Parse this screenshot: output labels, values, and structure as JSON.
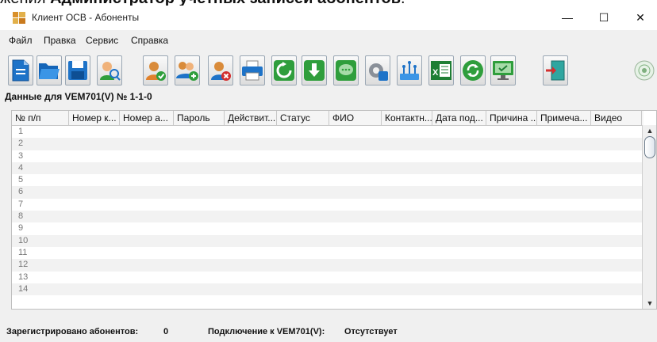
{
  "doc": {
    "prefix": "жения ",
    "bold": "Администратор учетных записей абонентов",
    "suffix": "."
  },
  "window": {
    "title": "Клиент ОСВ - Абоненты",
    "minimize": "—",
    "maximize": "☐",
    "close": "✕"
  },
  "menu": [
    "Файл",
    "Правка",
    "Сервис",
    "Справка"
  ],
  "toolbar": {
    "buttons": [
      "new-document-icon",
      "open-folder-icon",
      "save-icon",
      "search-user-icon",
      "user-check-icon",
      "add-users-icon",
      "remove-user-icon",
      "printer-icon",
      "refresh-icon",
      "download-icon",
      "chat-icon",
      "settings-icon",
      "network-icon",
      "excel-icon",
      "sync-icon",
      "monitor-icon",
      "exit-door-icon"
    ],
    "colors": {
      "accent": "#1e73c8",
      "green": "#2f9e3c",
      "gray": "#8a9099"
    }
  },
  "caption": "Данные для VEM701(V) № 1-1-0",
  "table": {
    "columns": [
      "№ п/п",
      "Номер к...",
      "Номер а...",
      "Пароль",
      "Действит...",
      "Статус",
      "ФИО",
      "Контактн...",
      "Дата под...",
      "Причина ...",
      "Примеча...",
      "Видео"
    ],
    "rows": [
      "1",
      "2",
      "3",
      "4",
      "5",
      "6",
      "7",
      "8",
      "9",
      "10",
      "11",
      "12",
      "13",
      "14"
    ]
  },
  "status": {
    "registered_label": "Зарегистрировано абонентов:",
    "registered_count": "0",
    "connection_label": "Подключение к VEM701(V):",
    "connection_value": "Отсутствует"
  }
}
